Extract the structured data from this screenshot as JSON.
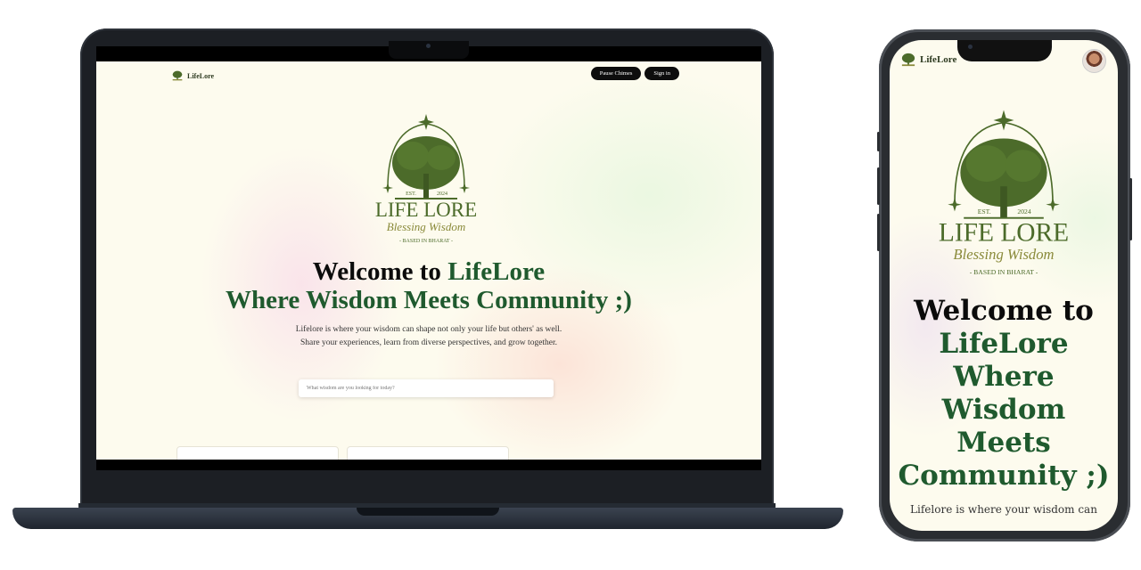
{
  "app": {
    "brand": "LifeLore",
    "logo": {
      "est": "EST.",
      "year": "2024",
      "title": "LIFE LORE",
      "tagline": "Blessing Wisdom",
      "sub": "- BASED IN BHARAT -"
    }
  },
  "header": {
    "pause_chimes_label": "Pause Chimes",
    "sign_in_label": "Sign in"
  },
  "hero": {
    "welcome_prefix": "Welcome to ",
    "welcome_brand": "LifeLore",
    "tagline_line": "Where Wisdom Meets Community ;)",
    "phone_lines": [
      "Where",
      "Wisdom",
      "Meets",
      "Community ;)"
    ],
    "description_1": "Lifelore is where your wisdom can shape not only your life but others' as well.",
    "description_2": "Share your experiences, learn from diverse perspectives, and grow together.",
    "phone_description": "Lifelore is where your wisdom can"
  },
  "search": {
    "placeholder": "What wisdom are you looking for today?"
  },
  "colors": {
    "accent_green": "#1f5a2e",
    "tree_green": "#4c6b2a",
    "logo_gold": "#8a8a3a",
    "button_black": "#0d0d0d"
  },
  "icons": [
    "tree-logo-icon",
    "avatar"
  ]
}
